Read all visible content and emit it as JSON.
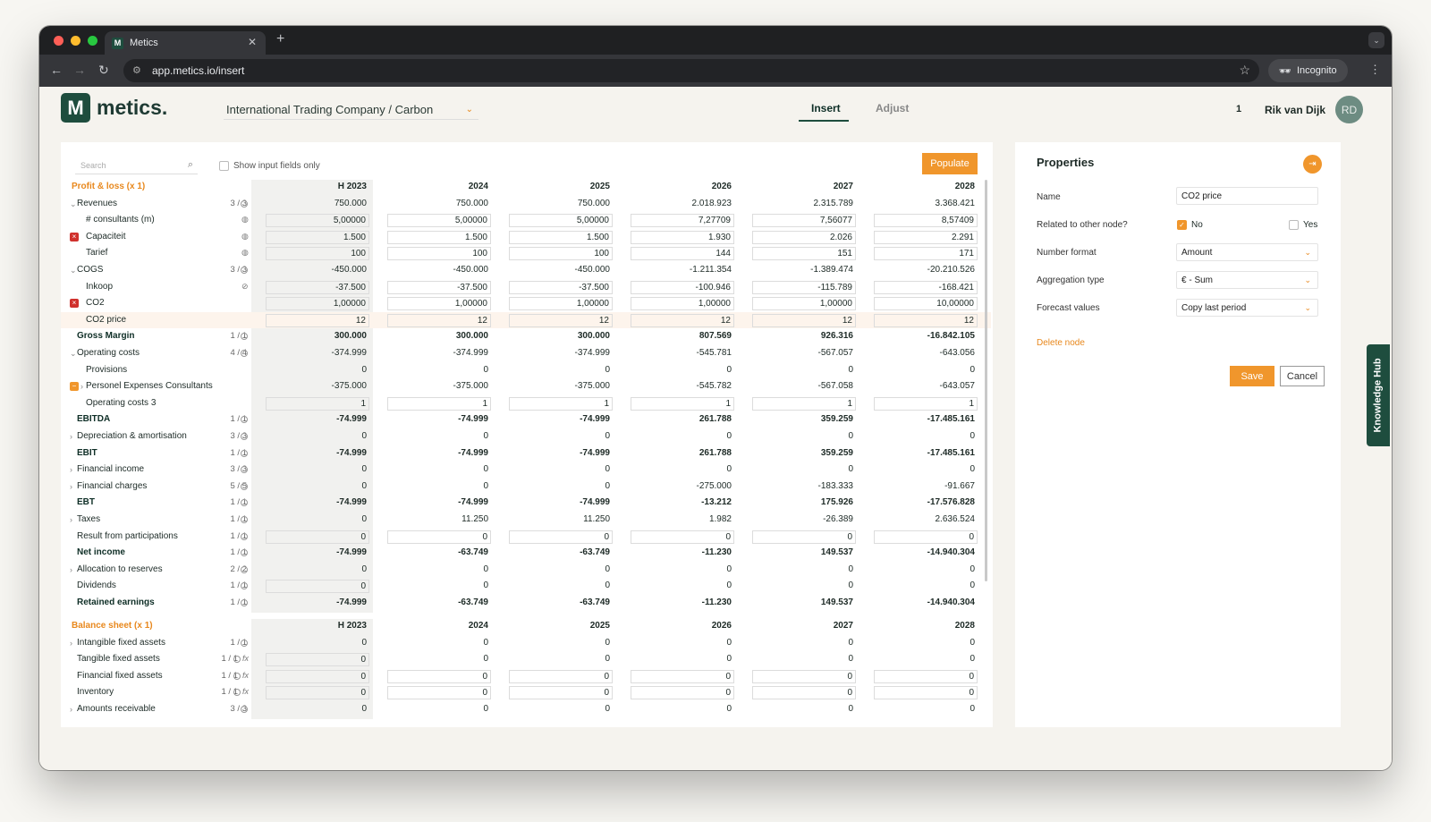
{
  "browser": {
    "tab_title": "Metics",
    "tab_close": "✕",
    "new_tab": "+",
    "url": "app.metics.io/insert",
    "incognito": "Incognito",
    "back": "←",
    "forward": "→",
    "reload": "↻",
    "menu": "⋮",
    "star": "☆"
  },
  "app": {
    "logo_mark": "M",
    "logo_text": "metics.",
    "company": "International Trading Company / Carbon",
    "tabs": [
      "Insert",
      "Adjust"
    ],
    "count": "1",
    "user": "Rik van Dijk",
    "avatar": "RD"
  },
  "table": {
    "search_placeholder": "Search",
    "show_input": "Show input fields only",
    "populate": "Populate",
    "years": [
      "H 2023",
      "2024",
      "2025",
      "2026",
      "2027",
      "2028"
    ],
    "pl_title": "Profit & loss (x 1)",
    "pl_rows": [
      {
        "label": "Revenues",
        "exp": "v",
        "count": "3 / 3",
        "icon": "clock",
        "vals": [
          "750.000",
          "750.000",
          "750.000",
          "2.018.923",
          "2.315.789",
          "3.368.421"
        ]
      },
      {
        "label": "# consultants (m)",
        "indent": 1,
        "icon": "fill",
        "box": true,
        "vals": [
          "5,00000",
          "5,00000",
          "5,00000",
          "7,27709",
          "7,56077",
          "8,57409"
        ]
      },
      {
        "label": "Capaciteit",
        "indent": 1,
        "mark": "x",
        "icon": "fill",
        "box": true,
        "vals": [
          "1.500",
          "1.500",
          "1.500",
          "1.930",
          "2.026",
          "2.291"
        ]
      },
      {
        "label": "Tarief",
        "indent": 1,
        "icon": "fill",
        "box": true,
        "vals": [
          "100",
          "100",
          "100",
          "144",
          "151",
          "171"
        ]
      },
      {
        "label": "COGS",
        "exp": "v",
        "count": "3 / 3",
        "icon": "clock",
        "vals": [
          "-450.000",
          "-450.000",
          "-450.000",
          "-1.211.354",
          "-1.389.474",
          "-20.210.526"
        ]
      },
      {
        "label": "Inkoop",
        "indent": 1,
        "icon": "link",
        "box": true,
        "vals": [
          "-37.500",
          "-37.500",
          "-37.500",
          "-100.946",
          "-115.789",
          "-168.421"
        ]
      },
      {
        "label": "CO2",
        "indent": 1,
        "mark": "x",
        "box": true,
        "vals": [
          "1,00000",
          "1,00000",
          "1,00000",
          "1,00000",
          "1,00000",
          "10,00000"
        ]
      },
      {
        "label": "CO2 price",
        "indent": 1,
        "hl": true,
        "box": true,
        "vals": [
          "12",
          "12",
          "12",
          "12",
          "12",
          "12"
        ]
      },
      {
        "label": "Gross Margin",
        "bold": true,
        "count": "1 / 1",
        "icon": "clock",
        "vals": [
          "300.000",
          "300.000",
          "300.000",
          "807.569",
          "926.316",
          "-16.842.105"
        ]
      },
      {
        "label": "Operating costs",
        "exp": "v",
        "count": "4 / 4",
        "icon": "clock",
        "vals": [
          "-374.999",
          "-374.999",
          "-374.999",
          "-545.781",
          "-567.057",
          "-643.056"
        ]
      },
      {
        "label": "Provisions",
        "indent": 1,
        "vals": [
          "0",
          "0",
          "0",
          "0",
          "0",
          "0"
        ]
      },
      {
        "label": "Personel Expenses Consultants",
        "indent": 1,
        "exp": ">",
        "mark": "o",
        "vals": [
          "-375.000",
          "-375.000",
          "-375.000",
          "-545.782",
          "-567.058",
          "-643.057"
        ]
      },
      {
        "label": "Operating costs 3",
        "indent": 1,
        "box": true,
        "vals": [
          "1",
          "1",
          "1",
          "1",
          "1",
          "1"
        ]
      },
      {
        "label": "EBITDA",
        "bold": true,
        "count": "1 / 1",
        "icon": "clock",
        "vals": [
          "-74.999",
          "-74.999",
          "-74.999",
          "261.788",
          "359.259",
          "-17.485.161"
        ]
      },
      {
        "label": "Depreciation & amortisation",
        "exp": ">",
        "count": "3 / 3",
        "icon": "clock",
        "vals": [
          "0",
          "0",
          "0",
          "0",
          "0",
          "0"
        ]
      },
      {
        "label": "EBIT",
        "bold": true,
        "count": "1 / 1",
        "icon": "clock",
        "vals": [
          "-74.999",
          "-74.999",
          "-74.999",
          "261.788",
          "359.259",
          "-17.485.161"
        ]
      },
      {
        "label": "Financial income",
        "exp": ">",
        "count": "3 / 3",
        "icon": "clock",
        "vals": [
          "0",
          "0",
          "0",
          "0",
          "0",
          "0"
        ]
      },
      {
        "label": "Financial charges",
        "exp": ">",
        "count": "5 / 5",
        "icon": "clock",
        "vals": [
          "0",
          "0",
          "0",
          "-275.000",
          "-183.333",
          "-91.667"
        ]
      },
      {
        "label": "EBT",
        "bold": true,
        "count": "1 / 1",
        "icon": "clock",
        "vals": [
          "-74.999",
          "-74.999",
          "-74.999",
          "-13.212",
          "175.926",
          "-17.576.828"
        ]
      },
      {
        "label": "Taxes",
        "exp": ">",
        "count": "1 / 1",
        "icon": "clock",
        "vals": [
          "0",
          "11.250",
          "11.250",
          "1.982",
          "-26.389",
          "2.636.524"
        ]
      },
      {
        "label": "Result from participations",
        "count": "1 / 1",
        "icon": "clock",
        "box": true,
        "vals": [
          "0",
          "0",
          "0",
          "0",
          "0",
          "0"
        ]
      },
      {
        "label": "Net income",
        "bold": true,
        "count": "1 / 1",
        "icon": "clock",
        "vals": [
          "-74.999",
          "-63.749",
          "-63.749",
          "-11.230",
          "149.537",
          "-14.940.304"
        ]
      },
      {
        "label": "Allocation to reserves",
        "exp": ">",
        "count": "2 / 2",
        "icon": "clock",
        "vals": [
          "0",
          "0",
          "0",
          "0",
          "0",
          "0"
        ]
      },
      {
        "label": "Dividends",
        "count": "1 / 1",
        "icon": "clock",
        "boxfirst": true,
        "vals": [
          "0",
          "0",
          "0",
          "0",
          "0",
          "0"
        ]
      },
      {
        "label": "Retained earnings",
        "bold": true,
        "count": "1 / 1",
        "icon": "clock",
        "vals": [
          "-74.999",
          "-63.749",
          "-63.749",
          "-11.230",
          "149.537",
          "-14.940.304"
        ]
      }
    ],
    "bs_title": "Balance sheet (x 1)",
    "bs_rows": [
      {
        "label": "Intangible fixed assets",
        "exp": ">",
        "count": "1 / 1",
        "icon": "clock",
        "vals": [
          "0",
          "0",
          "0",
          "0",
          "0",
          "0"
        ]
      },
      {
        "label": "Tangible fixed assets",
        "count": "1 / 1",
        "icon": "clockfx",
        "boxfirst": true,
        "vals": [
          "0",
          "0",
          "0",
          "0",
          "0",
          "0"
        ]
      },
      {
        "label": "Financial fixed assets",
        "count": "1 / 1",
        "icon": "clockfx",
        "box": true,
        "vals": [
          "0",
          "0",
          "0",
          "0",
          "0",
          "0"
        ]
      },
      {
        "label": "Inventory",
        "count": "1 / 1",
        "icon": "clockfx",
        "box": true,
        "vals": [
          "0",
          "0",
          "0",
          "0",
          "0",
          "0"
        ]
      },
      {
        "label": "Amounts receivable",
        "exp": ">",
        "count": "3 / 3",
        "icon": "clock",
        "vals": [
          "0",
          "0",
          "0",
          "0",
          "0",
          "0"
        ]
      }
    ]
  },
  "properties": {
    "title": "Properties",
    "name_label": "Name",
    "name_value": "CO2 price",
    "related_label": "Related to other node?",
    "related_no": "No",
    "related_yes": "Yes",
    "format_label": "Number format",
    "format_value": "Amount",
    "agg_label": "Aggregation type",
    "agg_value": "€ - Sum",
    "forecast_label": "Forecast values",
    "forecast_value": "Copy last period",
    "delete": "Delete node",
    "save": "Save",
    "cancel": "Cancel"
  },
  "knowledge_hub": "Knowledge Hub",
  "colors": {
    "brand": "#1e4d3e",
    "accent": "#f0962c",
    "red_mark": "#d0312d"
  }
}
